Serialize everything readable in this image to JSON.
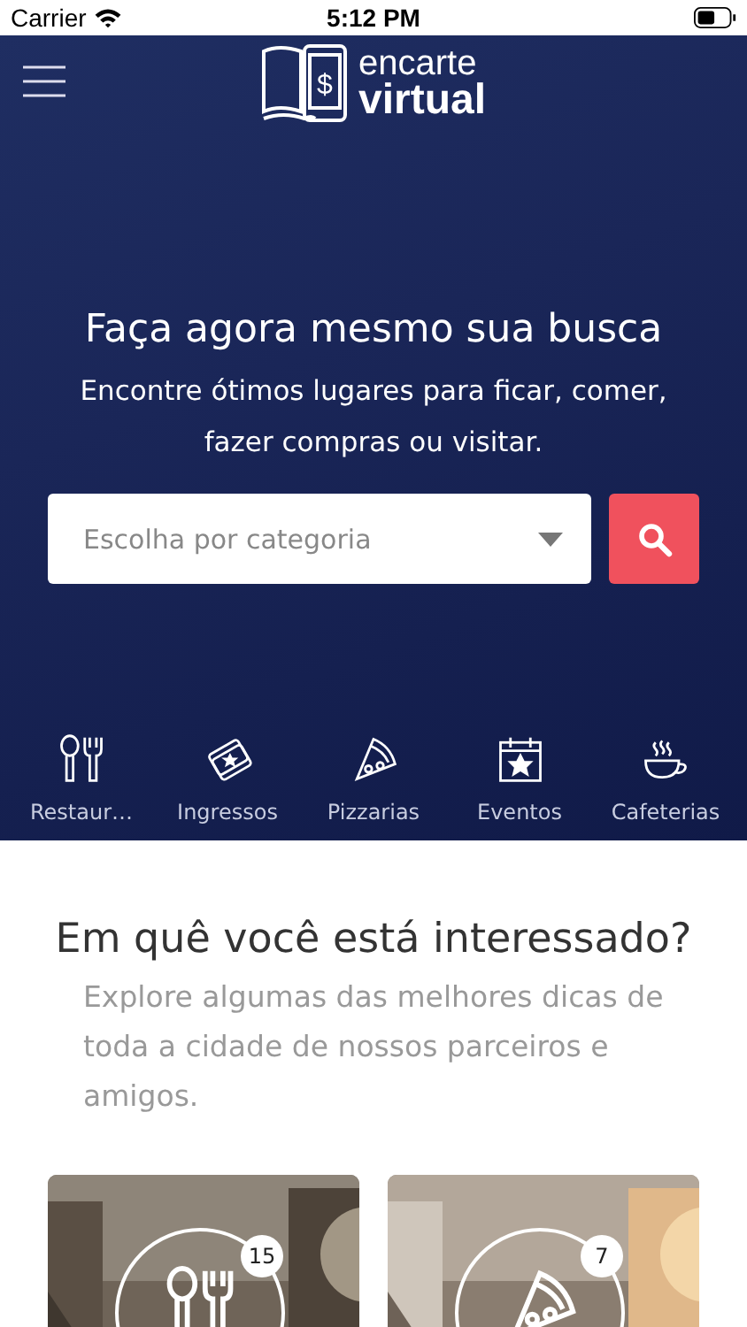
{
  "status_bar": {
    "carrier": "Carrier",
    "time": "5:12 PM"
  },
  "header": {
    "logo_symbol": "$",
    "logo_top": "encarte",
    "logo_bottom": "virtual"
  },
  "search": {
    "title": "Faça agora mesmo sua busca",
    "subtitle": "Encontre ótimos lugares para ficar, comer, fazer compras ou visitar.",
    "placeholder": "Escolha por categoria"
  },
  "categories": [
    {
      "label": "Restaur…",
      "kind": "restaurant"
    },
    {
      "label": "Ingressos",
      "kind": "tickets"
    },
    {
      "label": "Pizzarias",
      "kind": "pizza"
    },
    {
      "label": "Eventos",
      "kind": "calendar"
    },
    {
      "label": "Cafeterias",
      "kind": "coffee"
    }
  ],
  "section": {
    "title": "Em quê você está interessado?",
    "text": "Explore algumas das melhores dicas de toda a cidade de nossos parceiros e amigos."
  },
  "cards": [
    {
      "kind": "restaurant",
      "count": "15"
    },
    {
      "kind": "pizza",
      "count": "7"
    }
  ]
}
